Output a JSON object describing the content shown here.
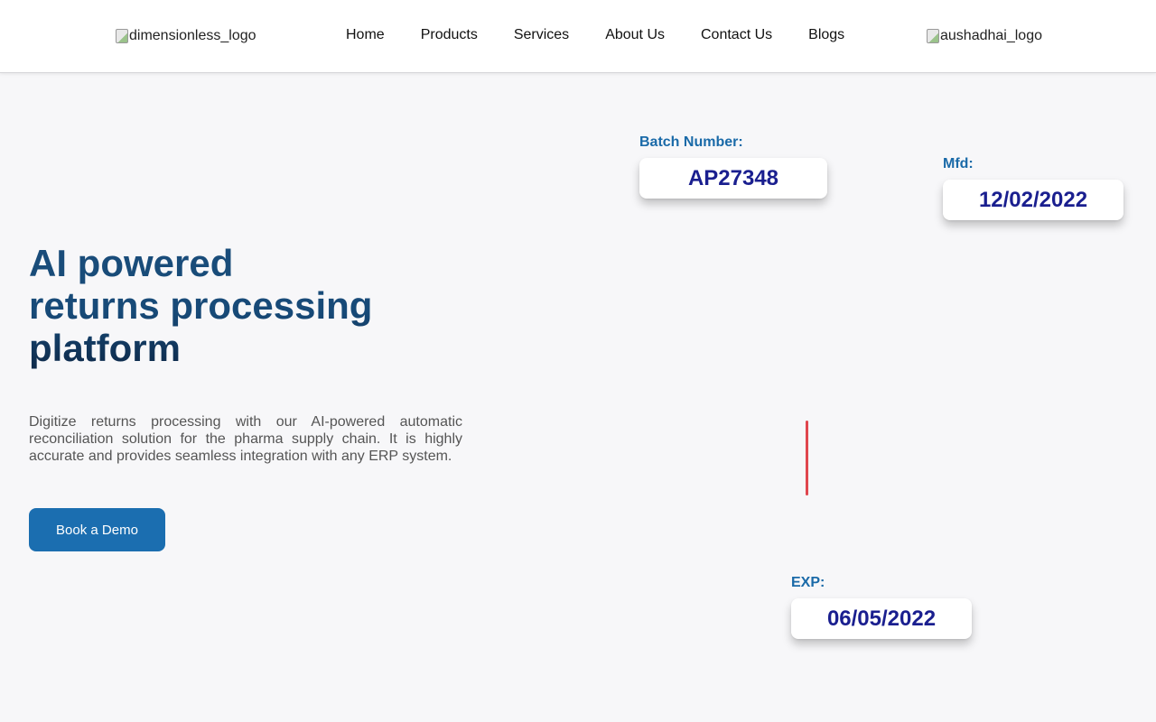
{
  "header": {
    "logo_left_alt": "dimensionless_logo",
    "logo_right_alt": "aushadhai_logo",
    "nav": [
      "Home",
      "Products",
      "Services",
      "About Us",
      "Contact Us",
      "Blogs"
    ]
  },
  "hero": {
    "title_lines": [
      "AI powered",
      "returns processing",
      "platform"
    ],
    "description": "Digitize returns processing with our AI-powered automatic reconciliation solution for the pharma supply chain. It is highly accurate and provides seamless integration with any ERP system.",
    "cta_label": "Book a Demo"
  },
  "fields": {
    "batch": {
      "label": "Batch Number:",
      "value": "AP27348"
    },
    "mfd": {
      "label": "Mfd:",
      "value": "12/02/2022"
    },
    "exp": {
      "label": "EXP:",
      "value": "06/05/2022"
    }
  },
  "colors": {
    "accent": "#1b6eb0",
    "title_blue": "#174a78",
    "field_label": "#1a6aa8",
    "field_value": "#1a1f8f",
    "scan_line": "#e0464e"
  }
}
